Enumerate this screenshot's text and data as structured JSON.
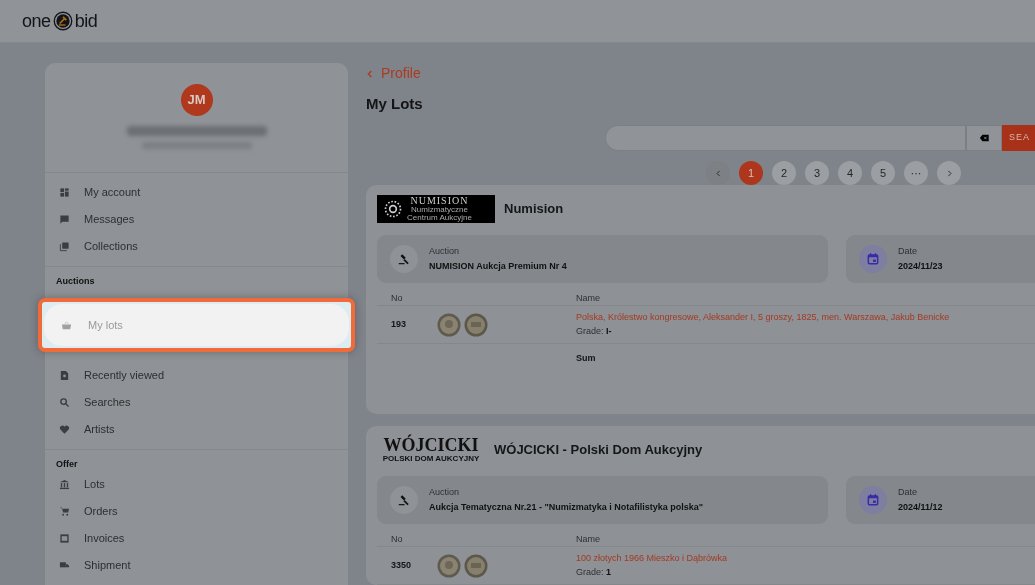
{
  "header": {
    "logo_left": "one",
    "logo_right": "bid"
  },
  "profile": {
    "initials": "JM"
  },
  "sidebar": {
    "sections": [
      {
        "items": [
          {
            "label": "My account",
            "selected": false
          },
          {
            "label": "Messages",
            "selected": false
          },
          {
            "label": "Collections",
            "selected": false
          }
        ]
      },
      {
        "title": "Auctions",
        "items": [
          {
            "label": "My lots",
            "selected": true
          },
          {
            "label": "Recently viewed",
            "selected": false
          },
          {
            "label": "Searches",
            "selected": false
          },
          {
            "label": "Artists",
            "selected": false
          }
        ]
      },
      {
        "title": "Offer",
        "items": [
          {
            "label": "Lots",
            "selected": false
          },
          {
            "label": "Orders",
            "selected": false
          },
          {
            "label": "Invoices",
            "selected": false
          },
          {
            "label": "Shipment",
            "selected": false
          }
        ]
      }
    ]
  },
  "breadcrumb": "Profile",
  "page_title": "My Lots",
  "search": {
    "button": "SEA"
  },
  "pagination": {
    "pages": [
      {
        "label": "1",
        "selected": true
      },
      {
        "label": "2",
        "selected": false
      },
      {
        "label": "3",
        "selected": false
      },
      {
        "label": "4",
        "selected": false
      },
      {
        "label": "5",
        "selected": false
      },
      {
        "label": "···",
        "selected": false
      }
    ]
  },
  "auction_houses": [
    {
      "logo": {
        "kind": "numision",
        "lines": [
          "NUMISION",
          "Numizmatyczne",
          "Centrum Aukcyjne"
        ]
      },
      "name": "Numision",
      "auction_label": "Auction",
      "auction": "NUMISION Aukcja Premium Nr 4",
      "date_label": "Date",
      "date": "2024/11/23",
      "columns": [
        "No",
        "Name"
      ],
      "lots": [
        {
          "no": "193",
          "title": "Polska, Królestwo kongresowe, Aleksander I, 5 groszy, 1825, men. Warszawa, Jakub Benicke",
          "grade_label": "Grade:",
          "grade": "I-"
        }
      ],
      "sum_label": "Sum"
    },
    {
      "logo": {
        "kind": "wojcicki",
        "lines": [
          "WÓJCICKI",
          "POLSKI DOM AUKCYJNY"
        ]
      },
      "name": "WÓJCICKI - Polski Dom Aukcyjny",
      "auction_label": "Auction",
      "auction": "Aukcja Tematyczna Nr.21 - \"Numizmatyka i Notafilistyka polska\"",
      "date_label": "Date",
      "date": "2024/11/12",
      "columns": [
        "No",
        "Name"
      ],
      "lots": [
        {
          "no": "3350",
          "title": "100 złotych 1966 Mieszko i Dąbrówka",
          "grade_label": "Grade:",
          "grade": "1"
        }
      ]
    }
  ]
}
